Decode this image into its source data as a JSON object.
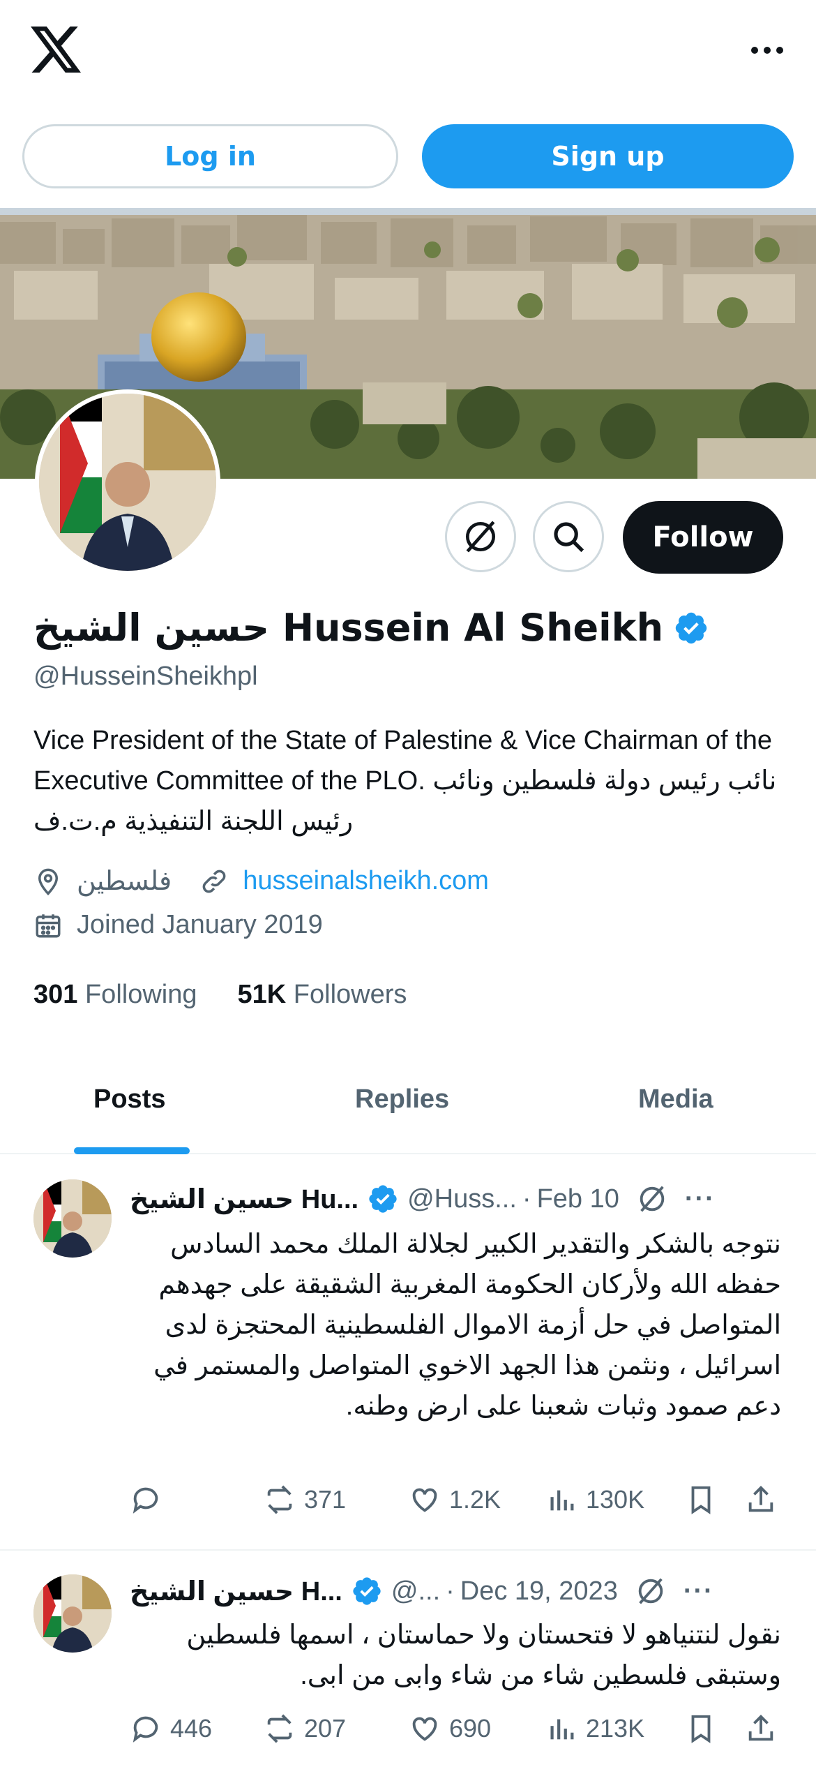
{
  "header": {
    "logo": "x-logo",
    "more": "more-options-icon"
  },
  "auth": {
    "login_label": "Log in",
    "signup_label": "Sign up"
  },
  "profile": {
    "name": "حسين الشيخ Hussein Al Sheikh",
    "handle": "@HusseinSheikhpl",
    "bio": "Vice President of the State of Palestine & Vice Chairman of the Executive Committee of the PLO. نائب رئيس دولة فلسطين ونائب رئيس اللجنة التنفيذية م.ت.ف",
    "location": "فلسطين",
    "website": "husseinalsheikh.com",
    "joined": "Joined January 2019",
    "following_count": "301",
    "following_label": "Following",
    "followers_count": "51K",
    "followers_label": "Followers",
    "follow_label": "Follow"
  },
  "tabs": [
    {
      "label": "Posts",
      "active": true
    },
    {
      "label": "Replies",
      "active": false
    },
    {
      "label": "Media",
      "active": false
    }
  ],
  "posts": [
    {
      "name": "حسين الشيخ Hu...",
      "handle": "@Huss...",
      "date": "Feb 10",
      "text": "نتوجه بالشكر والتقدير الكبير لجلالة الملك محمد السادس حفظه الله ولأركان الحكومة المغربية الشقيقة على جهدهم المتواصل في حل أزمة الاموال الفلسطينية المحتجزة لدى اسرائيل ، ونثمن هذا الجهد الاخوي المتواصل والمستمر في دعم صمود وثبات شعبنا على ارض وطنه.",
      "replies": "",
      "reposts": "371",
      "likes": "1.2K",
      "views": "130K"
    },
    {
      "name": "حسين الشيخ H...",
      "handle": "@...",
      "date": "Dec 19, 2023",
      "text": "نقول لنتنياهو لا فتحستان ولا حماستان ، اسمها فلسطين وستبقى فلسطين شاء من شاء وابى من ابى.",
      "replies": "446",
      "reposts": "207",
      "likes": "690",
      "views": "213K"
    }
  ],
  "colors": {
    "accent": "#1d9bf0",
    "text": "#0f1419",
    "muted": "#536471",
    "border": "#cfd9de"
  }
}
